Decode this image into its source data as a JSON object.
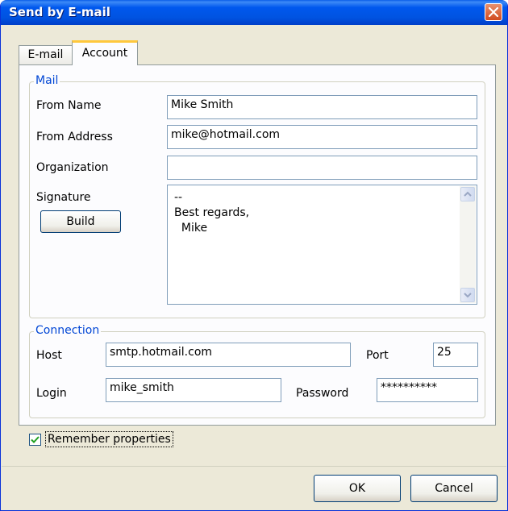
{
  "window": {
    "title": "Send by E-mail"
  },
  "tabs": [
    {
      "label": "E-mail"
    },
    {
      "label": "Account"
    }
  ],
  "mail": {
    "legend": "Mail",
    "from_name_label": "From Name",
    "from_name_value": "Mike Smith",
    "from_address_label": "From Address",
    "from_address_value": "mike@hotmail.com",
    "organization_label": "Organization",
    "organization_value": "",
    "signature_label": "Signature",
    "build_button": "Build",
    "signature_value": "--\nBest regards,\n  Mike"
  },
  "connection": {
    "legend": "Connection",
    "host_label": "Host",
    "host_value": "smtp.hotmail.com",
    "port_label": "Port",
    "port_value": "25",
    "login_label": "Login",
    "login_value": "mike_smith",
    "password_label": "Password",
    "password_value": "**********"
  },
  "remember": {
    "label": "Remember properties",
    "checked": true
  },
  "buttons": {
    "ok": "OK",
    "cancel": "Cancel"
  }
}
